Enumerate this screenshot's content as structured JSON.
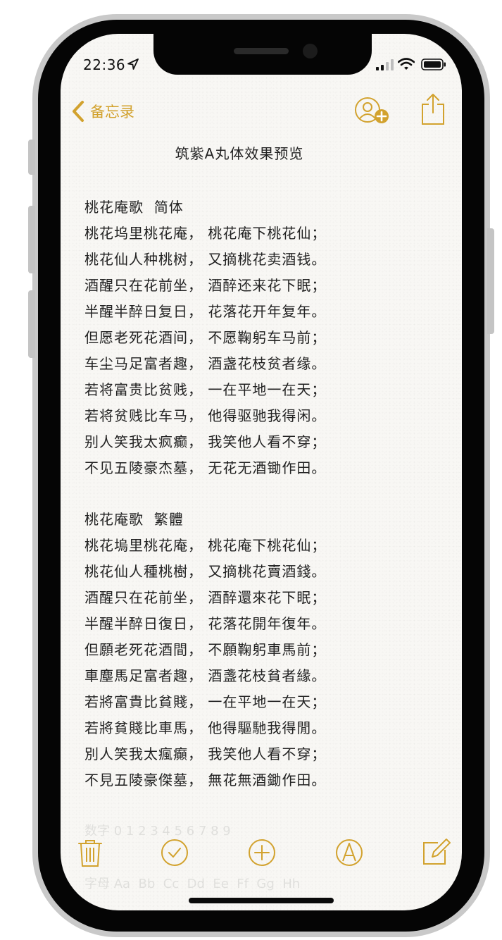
{
  "status": {
    "time": "22:36"
  },
  "nav": {
    "back_label": "备忘录"
  },
  "note": {
    "title": "筑紫A丸体效果预览",
    "sections": [
      {
        "heading": "桃花庵歌  简体",
        "lines": [
          "桃花坞里桃花庵， 桃花庵下桃花仙；",
          "桃花仙人种桃树， 又摘桃花卖酒钱。",
          "酒醒只在花前坐， 酒醉还来花下眠；",
          "半醒半醉日复日， 花落花开年复年。",
          "但愿老死花酒间， 不愿鞠躬车马前；",
          "车尘马足富者趣， 酒盏花枝贫者缘。",
          "若将富贵比贫贱， 一在平地一在天；",
          "若将贫贱比车马， 他得驱驰我得闲。",
          "别人笑我太疯癫， 我笑他人看不穿；",
          "不见五陵豪杰墓， 无花无酒锄作田。"
        ]
      },
      {
        "heading": "桃花庵歌  繁體",
        "lines": [
          "桃花塢里桃花庵， 桃花庵下桃花仙；",
          "桃花仙人種桃樹， 又摘桃花賣酒錢。",
          "酒醒只在花前坐， 酒醉還來花下眠；",
          "半醒半醉日復日， 花落花開年復年。",
          "但願老死花酒間， 不願鞠躬車馬前；",
          "車塵馬足富者趣， 酒盞花枝貧者緣。",
          "若將富貴比貧賤， 一在平地一在天；",
          "若將貧賤比車馬， 他得驅馳我得閒。",
          "別人笑我太瘋癲， 我笑他人看不穿；",
          "不見五陵豪傑墓， 無花無酒鋤作田。"
        ]
      }
    ],
    "faded_lines": [
      "数字 0 1 2 3 4 5 6 7 8 9",
      "字母 Aa  Bb  Cc  Dd  Ee  Ff  Gg  Hh"
    ]
  },
  "toolbar": {
    "icons": [
      "trash-icon",
      "checklist-icon",
      "add-icon",
      "markup-icon",
      "compose-icon"
    ]
  },
  "colors": {
    "accent": "#d2a22e",
    "paper": "#f8f7f4",
    "text": "#222222"
  }
}
